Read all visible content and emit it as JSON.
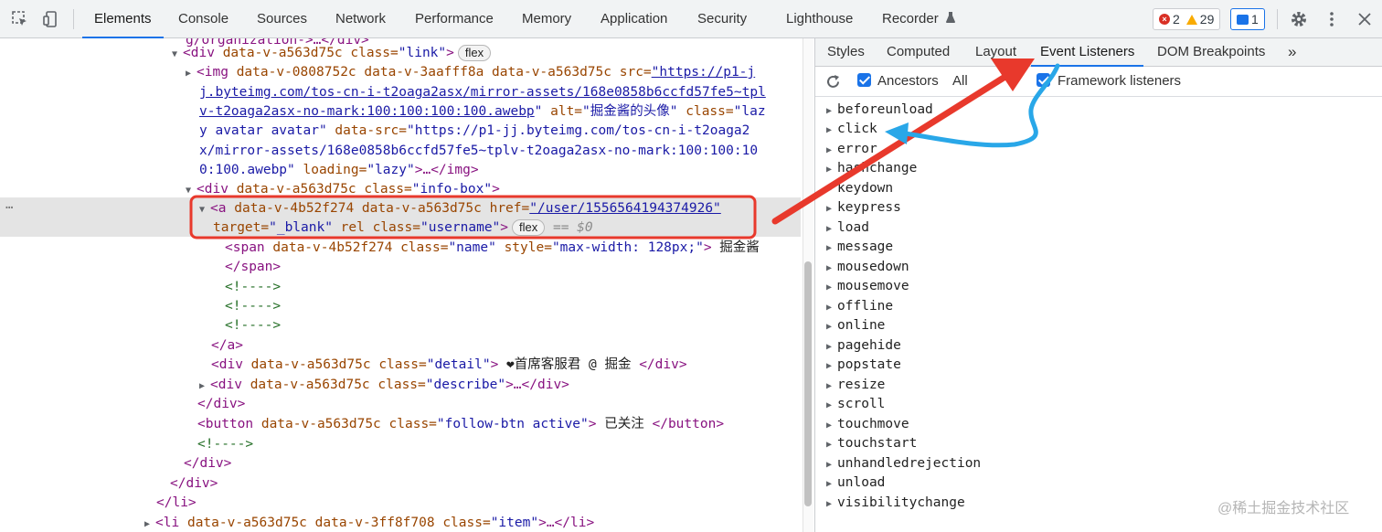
{
  "toolbar": {
    "tabs": [
      "Elements",
      "Console",
      "Sources",
      "Network",
      "Performance",
      "Memory",
      "Application",
      "Security",
      "Lighthouse",
      "Recorder"
    ],
    "active_tab": "Elements",
    "errors": "2",
    "warnings": "29",
    "messages": "1"
  },
  "elements": {
    "line0": "g/organization->…</div>",
    "line1_tag": "<div ",
    "line1_attr": "data-v-a563d75c class=",
    "line1_val": "\"link\"",
    "line1_end": ">",
    "line1_badge": "flex",
    "img1": "<img ",
    "img1_attr": "data-v-0808752c data-v-3aafff8a data-v-a563d75c src=",
    "img1_link": "\"https://p1-j",
    "img2": "j.byteimg.com/tos-cn-i-t2oaga2asx/mirror-assets/168e0858b6ccfd57fe5~tpl",
    "img3_link": "v-t2oaga2asx-no-mark:100:100:100:100.awebp",
    "img3_attr": " alt=",
    "img3_val": "\"掘金酱的头像\"",
    "img3_attr2": " class=",
    "img3_val2": "\"laz",
    "img4_val": "y avatar avatar\"",
    "img4_attr": " data-src=",
    "img4_val2": "\"https://p1-jj.byteimg.com/tos-cn-i-t2oaga2",
    "img5_val": "x/mirror-assets/168e0858b6ccfd57fe5~tplv-t2oaga2asx-no-mark:100:100:10",
    "img6_val": "0:100.awebp\"",
    "img6_attr": " loading=",
    "img6_val2": "\"lazy\"",
    "img6_end": ">…</img>",
    "div2_tag": "<div ",
    "div2_attr": "data-v-a563d75c class=",
    "div2_val": "\"info-box\"",
    "div2_end": ">",
    "a_tag": "<a ",
    "a_attr": "data-v-4b52f274 data-v-a563d75c href=",
    "a_link": "\"/user/1556564194374926\"",
    "a2_attr": "target=",
    "a2_val": "\"_blank\"",
    "a2_attr2": " rel class=",
    "a2_val2": "\"username\"",
    "a2_end": ">",
    "a2_badge": "flex",
    "a2_eq": " == $0",
    "span_tag": "<span ",
    "span_attr": "data-v-4b52f274 class=",
    "span_val": "\"name\"",
    "span_attr2": " style=",
    "span_val2": "\"max-width: 128px;\"",
    "span_end": ">",
    "span_txt": " 掘金酱",
    "span_close": "</span>",
    "comment": "<!---->",
    "a_close": "</a>",
    "detail_tag": "<div ",
    "detail_attr": "data-v-a563d75c class=",
    "detail_val": "\"detail\"",
    "detail_end": ">",
    "detail_txt": " ❤首席客服君 @ 掘金 ",
    "detail_close": "</div>",
    "desc_tag": "<div ",
    "desc_attr": "data-v-a563d75c class=",
    "desc_val": "\"describe\"",
    "desc_end": ">…</div>",
    "div_close": "</div>",
    "btn_tag": "<button ",
    "btn_attr": "data-v-a563d75c class=",
    "btn_val": "\"follow-btn active\"",
    "btn_end": ">",
    "btn_txt": " 已关注 ",
    "btn_close": "</button>",
    "li_close": "</li>",
    "li_tag": "<li ",
    "li_attr": "data-v-a563d75c data-v-3ff8f708 class=",
    "li_val": "\"item\"",
    "li_end": ">…</li>",
    "dots": "…"
  },
  "side_pane": {
    "tabs": [
      "Styles",
      "Computed",
      "Layout",
      "Event Listeners",
      "DOM Breakpoints"
    ],
    "active_tab": "Event Listeners",
    "more": "»",
    "ancestors_label": "Ancestors",
    "all_label": "All",
    "framework_label": "Framework listeners",
    "events": [
      "beforeunload",
      "click",
      "error",
      "hashchange",
      "keydown",
      "keypress",
      "load",
      "message",
      "mousedown",
      "mousemove",
      "offline",
      "online",
      "pagehide",
      "popstate",
      "resize",
      "scroll",
      "touchmove",
      "touchstart",
      "unhandledrejection",
      "unload",
      "visibilitychange"
    ]
  },
  "watermark": "@稀土掘金技术社区",
  "colors": {
    "accent": "#1a73e8",
    "annotation_red": "#e8392c",
    "annotation_blue": "#29a7e8"
  }
}
